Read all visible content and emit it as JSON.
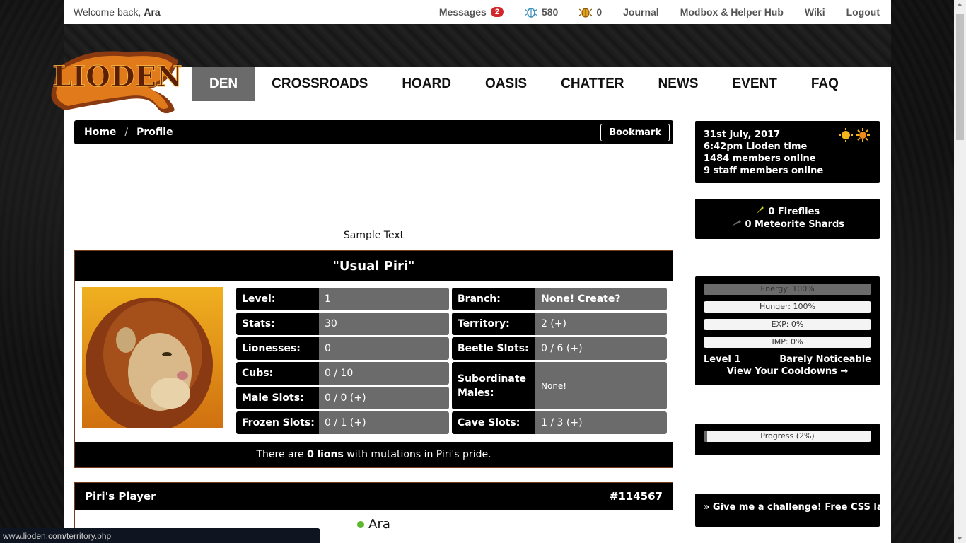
{
  "topbar": {
    "welcome_prefix": "Welcome back,",
    "username": "Ara",
    "messages_label": "Messages",
    "messages_count": "2",
    "beetles_blue": "580",
    "beetles_gold": "0",
    "links": [
      "Journal",
      "Modbox & Helper Hub",
      "Wiki",
      "Logout"
    ]
  },
  "logo_text": "LIODEN",
  "nav": {
    "tabs": [
      "DEN",
      "CROSSROADS",
      "HOARD",
      "OASIS",
      "CHATTER",
      "NEWS",
      "EVENT",
      "FAQ"
    ],
    "active": "DEN"
  },
  "breadcrumb": {
    "home": "Home",
    "separator": "/",
    "current": "Profile",
    "bookmark": "Bookmark"
  },
  "sample_text": "Sample Text",
  "profile": {
    "title": "\"Usual Piri\"",
    "stats_left": [
      {
        "key": "Level:",
        "value": "1"
      },
      {
        "key": "Stats:",
        "value": "30"
      },
      {
        "key": "Lionesses:",
        "value": "0"
      },
      {
        "key": "Cubs:",
        "value": "0 / 10"
      },
      {
        "key": "Male Slots:",
        "value": "0 / 0 (+)"
      },
      {
        "key": "Frozen Slots:",
        "value": "0 / 1 (+)"
      }
    ],
    "stats_right": [
      {
        "key": "Branch:",
        "value": "None! Create?"
      },
      {
        "key": "Territory:",
        "value": "2 (+)"
      },
      {
        "key": "Beetle Slots:",
        "value": "0 / 6 (+)"
      },
      {
        "key": "Subordinate Males:",
        "value": "None!"
      },
      {
        "key": "Cave Slots:",
        "value": "1 / 3 (+)"
      }
    ],
    "mutations_prefix": "There are",
    "mutations_count": "0",
    "mutations_suffix": "lions",
    "mutations_rest": "with mutations in Piri's pride."
  },
  "player": {
    "title": "Piri's Player",
    "id": "#114567",
    "name": "Ara",
    "status_color": "#5cb82a"
  },
  "status_url": "www.lioden.com/territory.php",
  "sidebar": {
    "date": "31st July, 2017",
    "time": "6:42pm Lioden time",
    "members_online": "1484 members online",
    "staff_online": "9 staff members online",
    "fireflies": "0 Fireflies",
    "meteorite": "0 Meteorite Shards",
    "bars": [
      {
        "label": "Energy: 100%",
        "fill": 1.0
      },
      {
        "label": "Hunger: 100%",
        "fill": 0
      },
      {
        "label": "EXP: 0%",
        "fill": 0
      },
      {
        "label": "IMP: 0%",
        "fill": 0
      }
    ],
    "level": "Level 1",
    "level_desc": "Barely Noticeable",
    "cooldowns": "View Your Cooldowns →",
    "progress_label": "Progress (2%)",
    "progress_fill": 0.02,
    "challenge": "» Give me a challenge! Free CSS layo"
  }
}
